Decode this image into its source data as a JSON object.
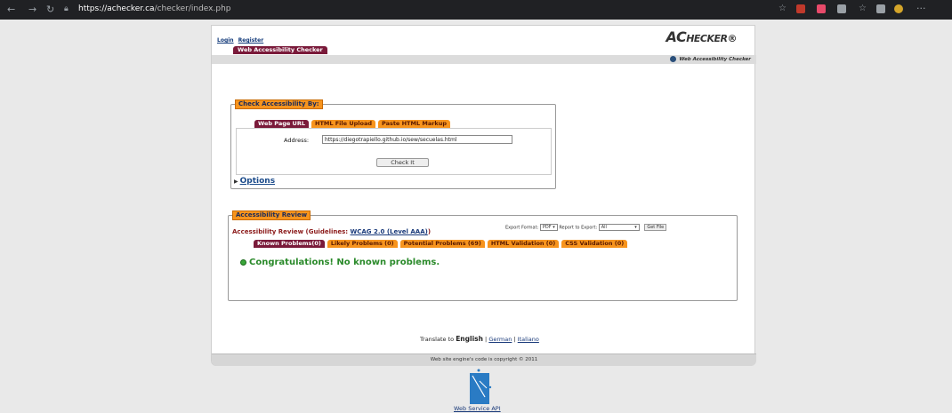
{
  "browser": {
    "url_host": "https://achecker.ca",
    "url_path": "/checker/index.php"
  },
  "header": {
    "login": "Login",
    "register": "Register",
    "tab": "Web Accessibility Checker",
    "logo_big": "AC",
    "logo_rest": "HECKER",
    "logo_reg": "®",
    "bar_title": "Web Accessibility Checker"
  },
  "check": {
    "legend": "Check Accessibility By:",
    "tabs": [
      "Web Page URL",
      "HTML File Upload",
      "Paste HTML Markup"
    ],
    "address_label": "Address:",
    "address_value": "https://diegotrapiello.github.io/sew/secuelas.html",
    "button": "Check It",
    "options": "Options"
  },
  "review": {
    "legend": "Accessibility Review",
    "title_prefix": "Accessibility Review (Guidelines: ",
    "guideline": "WCAG 2.0 (Level AAA)",
    "title_suffix": ")",
    "export_format_label": "Export Format:",
    "export_format_value": "PDF",
    "report_label": "Report to Export:",
    "report_value": "All",
    "get_file": "Get File",
    "tabs": [
      "Known Problems(0)",
      "Likely Problems (0)",
      "Potential Problems (69)",
      "HTML Validation (0)",
      "CSS Validation (0)"
    ],
    "message": "Congratulations! No known problems."
  },
  "footer": {
    "translate_prefix": "Translate to",
    "english": "English",
    "german": "German",
    "italian": "Italiano",
    "sep": "|",
    "copyright": "Web site engine's code is copyright © 2011"
  },
  "ws": {
    "label": "Web Service API"
  }
}
